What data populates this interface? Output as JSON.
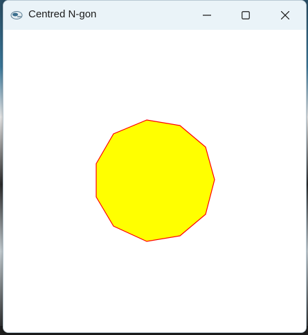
{
  "window": {
    "title": "Centred N-gon"
  },
  "icons": {
    "app": "app-icon",
    "minimize": "minimize-icon",
    "maximize": "maximize-icon",
    "close": "close-icon"
  },
  "shape": {
    "type": "polygon",
    "sides": 11,
    "fill": "#ffff00",
    "stroke": "#ff0000",
    "background": "#ffffff"
  },
  "colors": {
    "titlebar": "#eaf3f8",
    "client": "#ffffff"
  }
}
